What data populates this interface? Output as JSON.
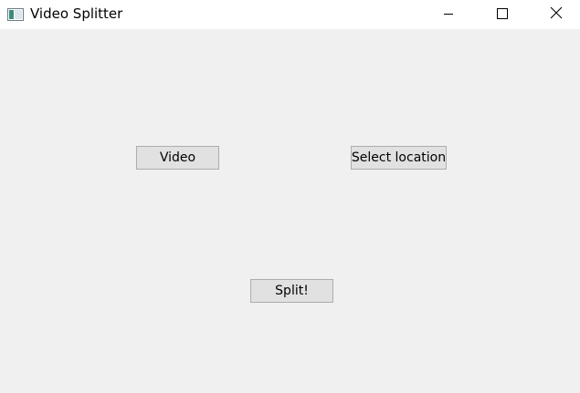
{
  "window": {
    "title": "Video Splitter",
    "controls": {
      "minimize": "minimize-icon",
      "maximize": "maximize-icon",
      "close": "close-icon"
    }
  },
  "main": {
    "video_label": "Video",
    "location_label": "Select location",
    "split_label": "Split!"
  },
  "colors": {
    "window_bg": "#f0f0f0",
    "titlebar_bg": "#ffffff",
    "button_bg": "#e1e1e1",
    "button_border": "#adadad"
  }
}
